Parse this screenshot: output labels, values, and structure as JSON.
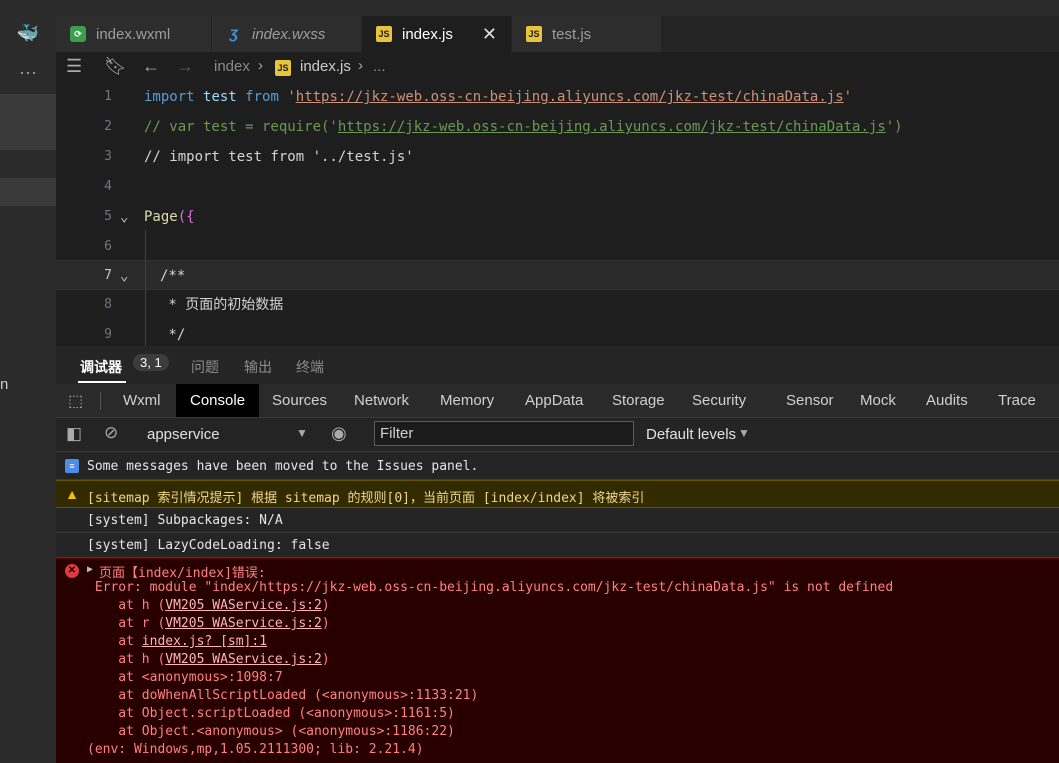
{
  "tabs": [
    {
      "label": "index.wxml",
      "icon": "wxml-file-icon"
    },
    {
      "label": "index.wxss",
      "icon": "css-file-icon"
    },
    {
      "label": "index.js",
      "icon": "js-file-icon",
      "active": true
    },
    {
      "label": "test.js",
      "icon": "js-file-icon"
    }
  ],
  "breadcrumb": {
    "folder": "index",
    "file": "index.js",
    "more": "..."
  },
  "editor": {
    "line_numbers": [
      "1",
      "2",
      "3",
      "4",
      "5",
      "6",
      "7",
      "8",
      "9"
    ],
    "lines": {
      "l1": {
        "kw": "import",
        "id": "test",
        "from": "from",
        "q1": "'",
        "url": "https://jkz-web.oss-cn-beijing.aliyuncs.com/jkz-test/chinaData.js",
        "q2": "'"
      },
      "l2": {
        "pre": "// var test = require('",
        "url": "https://jkz-web.oss-cn-beijing.aliyuncs.com/jkz-test/chinaData.js",
        "post": "')"
      },
      "l3": {
        "text": "// import test from '../test.js'"
      },
      "l5": {
        "fn": "Page",
        "br": "({"
      },
      "l7": {
        "text": "/**"
      },
      "l8": {
        "text": " * 页面的初始数据"
      },
      "l9": {
        "text": " */"
      }
    }
  },
  "panel": {
    "debugger_label": "调试器",
    "badge": "3, 1",
    "problems": "问题",
    "output": "输出",
    "terminal": "终端"
  },
  "devtools_tabs": [
    "Wxml",
    "Console",
    "Sources",
    "Network",
    "Memory",
    "AppData",
    "Storage",
    "Security",
    "Sensor",
    "Mock",
    "Audits",
    "Trace"
  ],
  "toolbar": {
    "context": "appservice",
    "filter_placeholder": "Filter",
    "levels": "Default levels"
  },
  "console": {
    "info": "Some messages have been moved to the Issues panel.",
    "warn": "[sitemap 索引情况提示] 根据 sitemap 的规则[0]，当前页面 [index/index] 将被索引",
    "sys1": "[system] Subpackages: N/A",
    "sys2": "[system] LazyCodeLoading: false",
    "error_title": "页面【index/index]错误:",
    "error_msg": " Error: module \"index/https://jkz-web.oss-cn-beijing.aliyuncs.com/jkz-test/chinaData.js\" is not defined",
    "stack": [
      {
        "pre": "    at h (",
        "link": "VM205 WAService.js:2",
        "post": ")"
      },
      {
        "pre": "    at r (",
        "link": "VM205 WAService.js:2",
        "post": ")"
      },
      {
        "pre": "    at ",
        "link": "index.js? [sm]:1",
        "post": ""
      },
      {
        "pre": "    at h (",
        "link": "VM205 WAService.js:2",
        "post": ")"
      },
      {
        "pre": "    at <anonymous>:1098:7",
        "link": "",
        "post": ""
      },
      {
        "pre": "    at doWhenAllScriptLoaded (<anonymous>:1133:21)",
        "link": "",
        "post": ""
      },
      {
        "pre": "    at Object.scriptLoaded (<anonymous>:1161:5)",
        "link": "",
        "post": ""
      },
      {
        "pre": "    at Object.<anonymous> (<anonymous>:1186:22)",
        "link": "",
        "post": ""
      }
    ],
    "env": "(env: Windows,mp,1.05.2111300; lib: 2.21.4)"
  },
  "sidebar_letter": "n"
}
